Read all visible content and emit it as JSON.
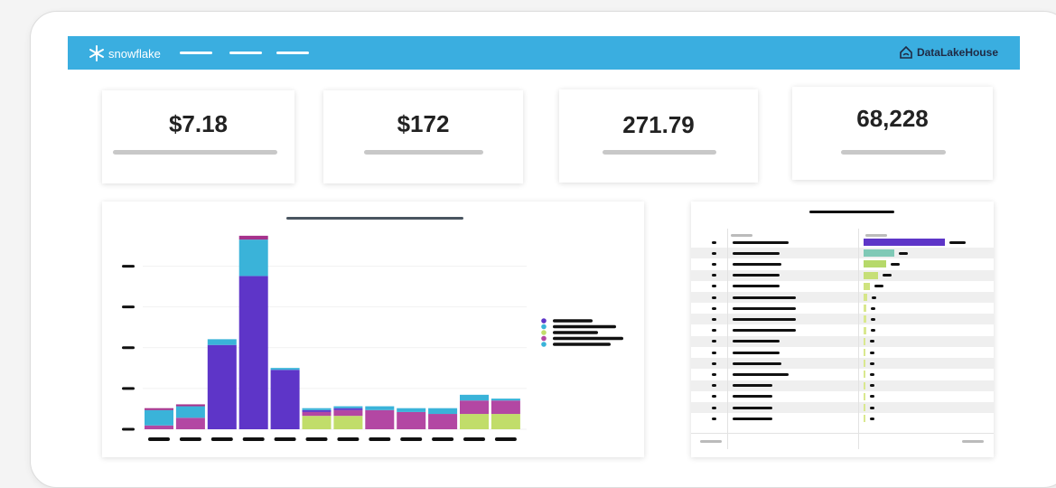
{
  "header": {
    "brand": "snowflake",
    "partner": "DataLakeHouse",
    "bar_color": "#3aaee0"
  },
  "kpis": [
    {
      "value": "$7.18"
    },
    {
      "value": "$172"
    },
    {
      "value": "271.79"
    },
    {
      "value": "68,228"
    }
  ],
  "chart_data": {
    "type": "bar",
    "stacked": true,
    "categories": [
      "",
      "",
      "",
      "",
      "",
      "",
      "",
      "",
      "",
      "",
      "",
      ""
    ],
    "ylim": [
      0,
      100
    ],
    "grid": true,
    "legend_position": "right",
    "series": [
      {
        "color": "#c1dd6a",
        "values": [
          0,
          0,
          0,
          0,
          0,
          7,
          7,
          0,
          0,
          0,
          8,
          8
        ]
      },
      {
        "color": "#b347a3",
        "values": [
          2,
          6,
          0,
          0,
          0,
          2,
          3,
          10,
          9,
          8,
          7,
          7
        ]
      },
      {
        "color": "#5e35c8",
        "values": [
          0,
          0,
          44,
          80,
          31,
          1,
          1,
          0,
          0,
          0,
          0,
          0
        ]
      },
      {
        "color": "#3ab3d9",
        "values": [
          8,
          6,
          3,
          19,
          1,
          1,
          1,
          2,
          2,
          3,
          3,
          1
        ]
      },
      {
        "color": "#a6328c",
        "values": [
          1,
          1,
          0,
          2,
          0,
          0,
          0,
          0,
          0,
          0,
          0,
          0
        ]
      }
    ],
    "legend_colors": [
      "#5e35c8",
      "#3ab3d9",
      "#c1dd6a",
      "#b347a3",
      "#3ab3d9"
    ]
  },
  "table_data": {
    "type": "table",
    "rows": 17,
    "bar_values": [
      100,
      38,
      28,
      18,
      8,
      4,
      3,
      3,
      3,
      2,
      2,
      2,
      2,
      2,
      2,
      2,
      2
    ],
    "bar_colors": [
      "#5e35c8",
      "#7fc9b6",
      "#b6d96a",
      "#c6df77",
      "#cfe37f",
      "#d6e68a",
      "#d9e88f",
      "#d9e88f",
      "#d9e88f",
      "#d9e88f",
      "#d9e88f",
      "#d9e88f",
      "#d9e88f",
      "#d9e88f",
      "#d9e88f",
      "#d9e88f",
      "#d9e88f"
    ]
  }
}
